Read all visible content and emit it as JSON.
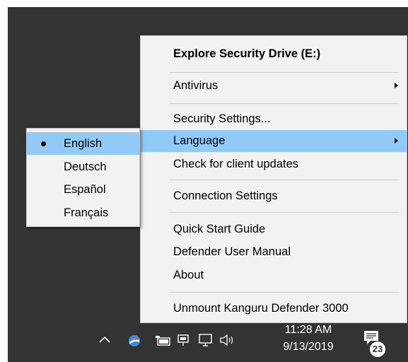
{
  "context_menu": {
    "items": [
      {
        "label": "Explore Security Drive (E:)"
      },
      {
        "label": "Antivirus"
      },
      {
        "label": "Security Settings..."
      },
      {
        "label": "Language"
      },
      {
        "label": "Check for client updates"
      },
      {
        "label": "Connection Settings"
      },
      {
        "label": "Quick Start Guide"
      },
      {
        "label": "Defender User Manual"
      },
      {
        "label": "About"
      },
      {
        "label": "Unmount Kanguru Defender 3000"
      }
    ],
    "highlighted": "Language"
  },
  "language_submenu": {
    "items": [
      {
        "label": "English"
      },
      {
        "label": "Deutsch"
      },
      {
        "label": "Español"
      },
      {
        "label": "Français"
      }
    ],
    "selected": "English"
  },
  "taskbar": {
    "time": "11:28 AM",
    "date": "9/13/2019",
    "notification_count": "23"
  },
  "colors": {
    "highlight": "#91c9f7",
    "menu_bg": "#f2f2f2",
    "taskbar_bg": "#333333"
  }
}
